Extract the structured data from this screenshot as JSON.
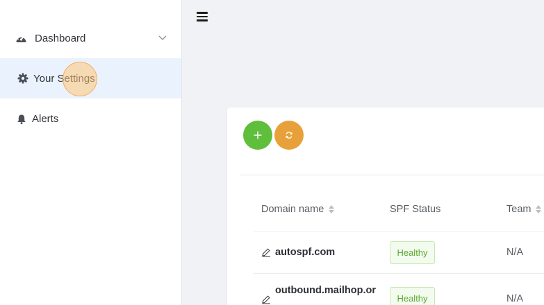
{
  "sidebar": {
    "items": [
      {
        "label": "Dashboard",
        "icon": "speedometer-icon"
      },
      {
        "label": "Your Settings",
        "icon": "gear-icon"
      },
      {
        "label": "Alerts",
        "icon": "bell-icon"
      }
    ]
  },
  "toolbar": {
    "add_button": "plus-icon",
    "refresh_button": "refresh-icon"
  },
  "table": {
    "columns": [
      "Domain name",
      "SPF Status",
      "Team"
    ],
    "rows": [
      {
        "domain": "autospf.com",
        "status": "Healthy",
        "team": "N/A"
      },
      {
        "domain": "outbound.mailhop.or",
        "status": "Healthy",
        "team": "N/A"
      }
    ]
  },
  "colors": {
    "add_button": "#5fbe3b",
    "refresh_button": "#e8a13a",
    "active_nav": "#eaf3fd",
    "healthy_text": "#5aaa2e"
  }
}
